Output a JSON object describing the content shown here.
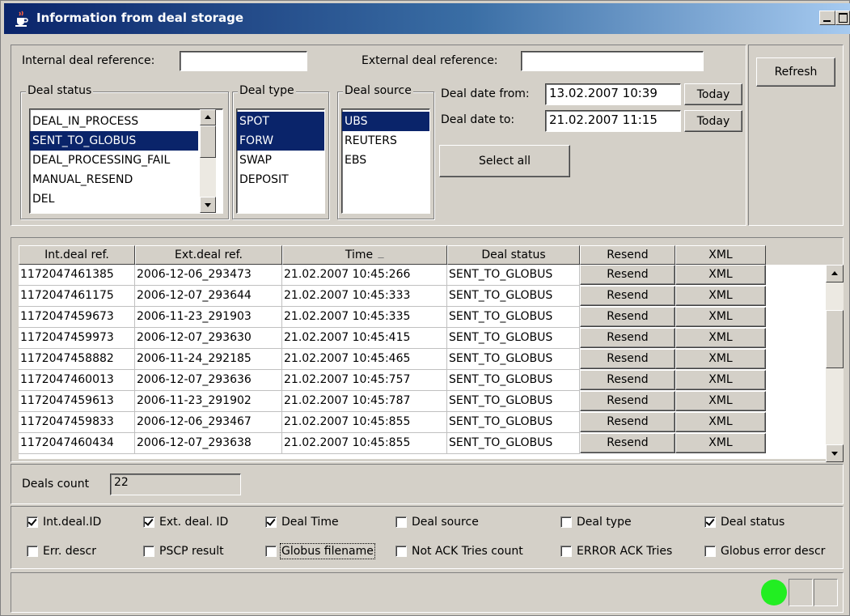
{
  "window": {
    "title": "Information from deal storage",
    "icon": "java-cup-icon"
  },
  "filters": {
    "internal_ref_label": "Internal deal reference:",
    "internal_ref_value": "",
    "external_ref_label": "External deal reference:",
    "external_ref_value": "",
    "refresh_label": "Refresh",
    "deal_status": {
      "legend": "Deal status",
      "items": [
        {
          "label": "DEAL_IN_PROCESS",
          "selected": false
        },
        {
          "label": "SENT_TO_GLOBUS",
          "selected": true
        },
        {
          "label": "DEAL_PROCESSING_FAIL",
          "selected": false
        },
        {
          "label": "MANUAL_RESEND",
          "selected": false
        },
        {
          "label": "DEL",
          "selected": false
        }
      ]
    },
    "deal_type": {
      "legend": "Deal type",
      "items": [
        {
          "label": "SPOT",
          "selected": true
        },
        {
          "label": "FORW",
          "selected": true
        },
        {
          "label": "SWAP",
          "selected": false
        },
        {
          "label": "DEPOSIT",
          "selected": false
        }
      ]
    },
    "deal_source": {
      "legend": "Deal source",
      "items": [
        {
          "label": "UBS",
          "selected": true
        },
        {
          "label": "REUTERS",
          "selected": false
        },
        {
          "label": "EBS",
          "selected": false
        }
      ]
    },
    "date_from_label": "Deal date from:",
    "date_from_value": "13.02.2007 10:39",
    "date_to_label": "Deal date to:",
    "date_to_value": "21.02.2007 11:15",
    "today_label": "Today",
    "select_all_label": "Select all"
  },
  "table": {
    "columns": [
      "Int.deal ref.",
      "Ext.deal ref.",
      "Time",
      "Deal status",
      "Resend",
      "XML"
    ],
    "sorted_column": "Time",
    "resend_label": "Resend",
    "xml_label": "XML",
    "rows": [
      [
        "1172047461385",
        "2006-12-06_293473",
        "21.02.2007 10:45:266",
        "SENT_TO_GLOBUS"
      ],
      [
        "1172047461175",
        "2006-12-07_293644",
        "21.02.2007 10:45:333",
        "SENT_TO_GLOBUS"
      ],
      [
        "1172047459673",
        "2006-11-23_291903",
        "21.02.2007 10:45:335",
        "SENT_TO_GLOBUS"
      ],
      [
        "1172047459973",
        "2006-12-07_293630",
        "21.02.2007 10:45:415",
        "SENT_TO_GLOBUS"
      ],
      [
        "1172047458882",
        "2006-11-24_292185",
        "21.02.2007 10:45:465",
        "SENT_TO_GLOBUS"
      ],
      [
        "1172047460013",
        "2006-12-07_293636",
        "21.02.2007 10:45:757",
        "SENT_TO_GLOBUS"
      ],
      [
        "1172047459613",
        "2006-11-23_291902",
        "21.02.2007 10:45:787",
        "SENT_TO_GLOBUS"
      ],
      [
        "1172047459833",
        "2006-12-06_293467",
        "21.02.2007 10:45:855",
        "SENT_TO_GLOBUS"
      ],
      [
        "1172047460434",
        "2006-12-07_293638",
        "21.02.2007 10:45:855",
        "SENT_TO_GLOBUS"
      ]
    ]
  },
  "deals_count": {
    "label": "Deals count",
    "value": "22"
  },
  "columns_toggle": {
    "row1": [
      {
        "label": "Int.deal.ID",
        "checked": true
      },
      {
        "label": "Ext. deal. ID",
        "checked": true
      },
      {
        "label": "Deal Time",
        "checked": true
      },
      {
        "label": "Deal source",
        "checked": false
      },
      {
        "label": "Deal type",
        "checked": false
      },
      {
        "label": "Deal status",
        "checked": true
      }
    ],
    "row2": [
      {
        "label": "Err. descr",
        "checked": false
      },
      {
        "label": "PSCP result",
        "checked": false
      },
      {
        "label": "Globus filename",
        "checked": false,
        "focused": true
      },
      {
        "label": "Not ACK Tries count",
        "checked": false
      },
      {
        "label": "ERROR ACK  Tries",
        "checked": false
      },
      {
        "label": "Globus error descr",
        "checked": false
      }
    ]
  },
  "status": {
    "indicator_color": "#22ee22"
  }
}
